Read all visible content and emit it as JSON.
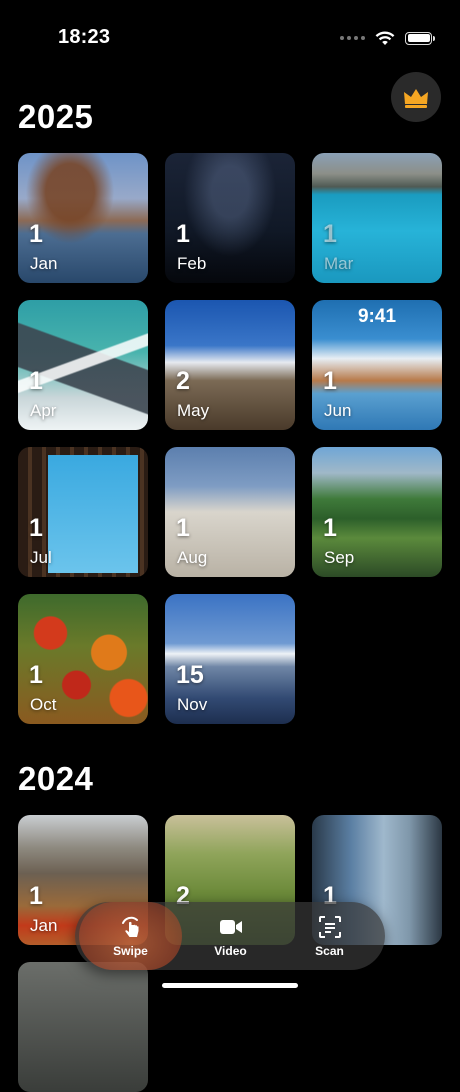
{
  "status_bar": {
    "time": "18:23"
  },
  "sections": [
    {
      "year": "2025",
      "tiles": [
        {
          "count": "1",
          "month": "Jan",
          "theme": "light"
        },
        {
          "count": "1",
          "month": "Feb",
          "theme": "dark"
        },
        {
          "count": "1",
          "month": "Mar",
          "theme": "faded"
        },
        {
          "count": "1",
          "month": "Apr",
          "theme": "light"
        },
        {
          "count": "2",
          "month": "May",
          "theme": "light"
        },
        {
          "count": "1",
          "month": "Jun",
          "theme": "light"
        },
        {
          "count": "1",
          "month": "Jul",
          "theme": "light"
        },
        {
          "count": "1",
          "month": "Aug",
          "theme": "light"
        },
        {
          "count": "1",
          "month": "Sep",
          "theme": "light"
        },
        {
          "count": "1",
          "month": "Oct",
          "theme": "light"
        },
        {
          "count": "15",
          "month": "Nov",
          "theme": "light"
        }
      ],
      "overlay_text": "9:41"
    },
    {
      "year": "2024",
      "tiles": [
        {
          "count": "1",
          "month": "Jan"
        },
        {
          "count": "2",
          "month": ""
        },
        {
          "count": "1",
          "month": ""
        }
      ]
    }
  ],
  "bottom_nav": {
    "items": [
      {
        "label": "Swipe",
        "icon": "swipe-hand-icon",
        "active": true
      },
      {
        "label": "Video",
        "icon": "video-camera-icon",
        "active": false
      },
      {
        "label": "Scan",
        "icon": "scan-document-icon",
        "active": false
      }
    ],
    "accent_color": "#f5a623"
  }
}
